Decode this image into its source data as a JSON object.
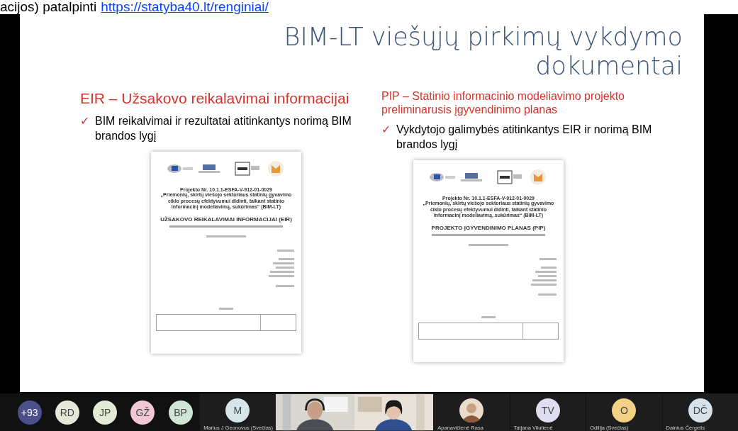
{
  "header": {
    "text": "acijos) patalpinti",
    "link": "https://statyba40.lt/renginiai/"
  },
  "slide": {
    "title_lines": [
      "BIM-LT viešųjų pirkimų vykdymo",
      "dokumentai"
    ],
    "columns": [
      {
        "heading": "EIR  – Užsakovo reikalavimai informacijai",
        "marker": "✓",
        "bullet": "BIM reikalvimai ir rezultatai atitinkantys norimą BIM brandos lygį",
        "document": {
          "project": "Projekto Nr. 10.1.1-ESFA-V-912-01-0029",
          "project_title": "„Priemonių, skirtų viešojo sektoriaus statinių gyvavimo ciklo procesų efektyvumui didinti, taikant statinio informacinį modeliavimą, sukūrimas“ (BIM-LT)",
          "title": "UŽSAKOVO REIKALAVIMAI INFORMACIJAI (EIR)"
        }
      },
      {
        "heading": "PIP – Statinio informacinio modeliavimo projekto preliminarusis įgyvendinimo planas",
        "marker": "✓",
        "bullet": "Vykdytojo galimybės  atitinkantys EIR ir norimą BIM brandos lygį",
        "document": {
          "project": "Projekto Nr. 10.1.1-ESFA-V-912-01-0029",
          "project_title": "„Priemonių, skirtų viešojo sektoriaus statinių gyvavimo ciklo procesų efektyvumui didinti, taikant statinio informacinį modeliavimą, sukūrimas“ (BIM-LT)",
          "title": "PROJEKTO ĮGYVENDINIMO PLANAS (PIP)"
        }
      }
    ]
  },
  "participants": [
    {
      "kind": "bubble",
      "initials": "+93",
      "color": "#4b4f8a"
    },
    {
      "kind": "bubble",
      "initials": "RD",
      "color": "#e3e9d6"
    },
    {
      "kind": "bubble",
      "initials": "JP",
      "color": "#e4ebd5"
    },
    {
      "kind": "bubble",
      "initials": "GŽ",
      "color": "#f2c8d5"
    },
    {
      "kind": "bubble",
      "initials": "BP",
      "color": "#cfe5d6"
    },
    {
      "kind": "tile",
      "initials": "M",
      "name": "Marius J Geonovus (Svečias)",
      "color": "#d6e5ea"
    },
    {
      "kind": "video"
    },
    {
      "kind": "video"
    },
    {
      "name": "Apanavičienė Rasa"
    },
    {
      "kind": "tile",
      "initials": "TV",
      "name": "Tatjana Vilutienė",
      "color": "#dfdef0"
    },
    {
      "kind": "tile",
      "initials": "O",
      "name": "Odilija (Svečias)",
      "color": "#f2d186"
    },
    {
      "kind": "tile",
      "initials": "DČ",
      "name": "Dainius Čergelis",
      "color": "#d6e1ea"
    }
  ]
}
